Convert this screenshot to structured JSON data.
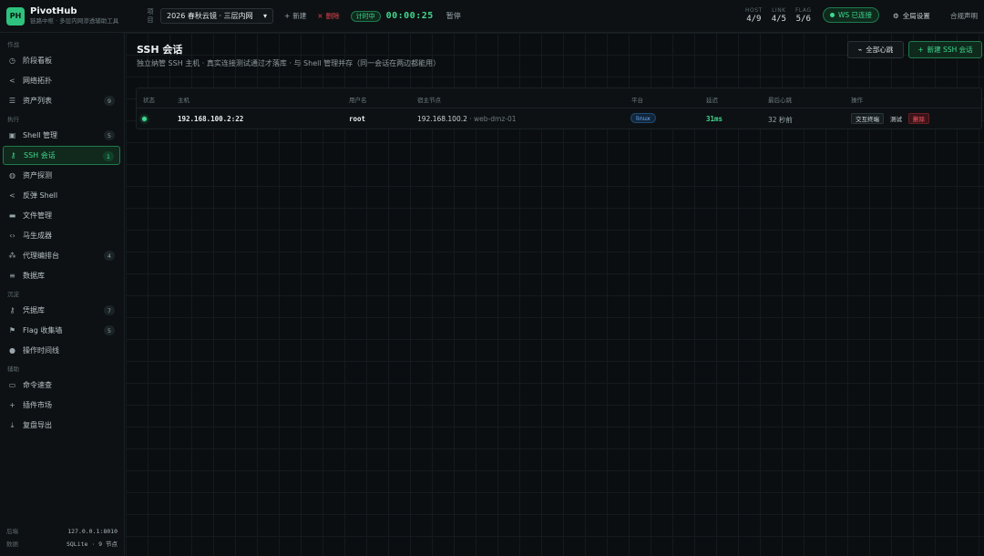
{
  "app": {
    "logo": "PH",
    "name": "PivotHub",
    "tagline": "链路中枢 · 多层内网渗透辅助工具"
  },
  "topbar": {
    "project_label": "项目",
    "project_value": "2026 春秋云镜 · 三层内网",
    "new_label": "新建",
    "delete_label": "删除",
    "timer_badge": "计时中",
    "timer": "00:00:25",
    "pause_label": "暂停",
    "stats": [
      {
        "key": "HOST",
        "value": "4/9"
      },
      {
        "key": "LINK",
        "value": "4/5"
      },
      {
        "key": "FLAG",
        "value": "5/6"
      }
    ],
    "ws_status": "WS 已连接",
    "settings_label": "全局设置",
    "legal_label": "合规声明"
  },
  "sidebar": {
    "sections": [
      {
        "title": "作战",
        "items": [
          {
            "id": "phase",
            "icon": "clock-icon",
            "label": "阶段看板",
            "count": ""
          },
          {
            "id": "topology",
            "icon": "share-icon",
            "label": "网络拓扑",
            "count": ""
          },
          {
            "id": "assets",
            "icon": "list-icon",
            "label": "资产列表",
            "count": "9"
          }
        ]
      },
      {
        "title": "执行",
        "items": [
          {
            "id": "shell",
            "icon": "terminal-icon",
            "label": "Shell 管理",
            "count": "5"
          },
          {
            "id": "ssh",
            "icon": "key-icon",
            "label": "SSH 会话",
            "count": "1",
            "active": true
          },
          {
            "id": "probe",
            "icon": "globe-icon",
            "label": "资产探测",
            "count": ""
          },
          {
            "id": "reverse",
            "icon": "share-icon",
            "label": "反弹 Shell",
            "count": ""
          },
          {
            "id": "files",
            "icon": "folder-icon",
            "label": "文件管理",
            "count": ""
          },
          {
            "id": "payload",
            "icon": "code-icon",
            "label": "马生成器",
            "count": ""
          },
          {
            "id": "proxy",
            "icon": "sitemap-icon",
            "label": "代理编排台",
            "count": "4"
          },
          {
            "id": "db",
            "icon": "database-icon",
            "label": "数据库",
            "count": ""
          }
        ]
      },
      {
        "title": "沉淀",
        "items": [
          {
            "id": "creds",
            "icon": "key-icon",
            "label": "凭据库",
            "count": "7"
          },
          {
            "id": "flags",
            "icon": "flag-icon",
            "label": "Flag 收集墙",
            "count": "5"
          },
          {
            "id": "timeline",
            "icon": "circle-icon",
            "label": "操作时间线",
            "count": ""
          }
        ]
      },
      {
        "title": "辅助",
        "items": [
          {
            "id": "cmds",
            "icon": "monitor-icon",
            "label": "命令速查",
            "count": ""
          },
          {
            "id": "plugins",
            "icon": "plus-icon",
            "label": "插件市场",
            "count": ""
          },
          {
            "id": "export",
            "icon": "download-icon",
            "label": "复盘导出",
            "count": ""
          }
        ]
      }
    ],
    "footer": [
      {
        "key": "后端",
        "value": "127.0.0.1:8010"
      },
      {
        "key": "数据",
        "value": "SQLite · 9 节点"
      }
    ]
  },
  "main": {
    "title": "SSH 会话",
    "subtitle": "独立纳管 SSH 主机 · 真实连接测试通过才落库 · 与 Shell 管理并存（同一会话在两边都能用）",
    "heartbeat_button": "全部心跳",
    "new_button": "新建 SSH 会话",
    "table": {
      "headers": [
        "状态",
        "主机",
        "用户名",
        "宿主节点",
        "平台",
        "延迟",
        "最后心跳",
        "操作"
      ],
      "rows": [
        {
          "status": "online",
          "host": "192.168.100.2:22",
          "user": "root",
          "jump_ip": "192.168.100.2",
          "jump_sep": " · ",
          "jump_name": "web-dmz-01",
          "platform": "linux",
          "latency": "31ms",
          "last_heartbeat": "32 秒前",
          "ops": [
            "交互终端",
            "测试",
            "删除"
          ]
        }
      ]
    }
  },
  "colors": {
    "accent": "#3fd98e",
    "danger": "#ff5a63",
    "info": "#6fb3ff"
  }
}
